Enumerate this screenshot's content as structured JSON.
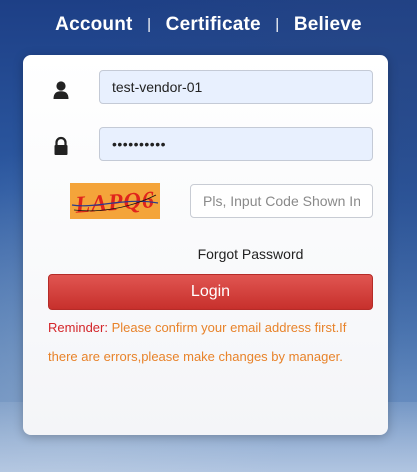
{
  "header": {
    "links": [
      "Account",
      "Certificate",
      "Believe"
    ],
    "separator": "|"
  },
  "form": {
    "username": {
      "value": "test-vendor-01",
      "icon": "user-icon"
    },
    "password": {
      "value": "••••••••••",
      "icon": "lock-icon"
    },
    "captcha": {
      "image_text": "LAPQ6",
      "placeholder": "Pls, Input Code Shown In"
    },
    "forgot_label": "Forgot Password",
    "login_label": "Login"
  },
  "reminder": {
    "label": "Reminder:",
    "text": "Please confirm your email address first.If there are errors,please make changes by manager."
  },
  "colors": {
    "login_button": "#d03e3a",
    "reminder_label": "#d4262a",
    "reminder_text": "#e8832a",
    "captcha_bg": "#f4a43a",
    "captcha_text": "#e0241c",
    "input_fill": "#e8f0fe"
  }
}
